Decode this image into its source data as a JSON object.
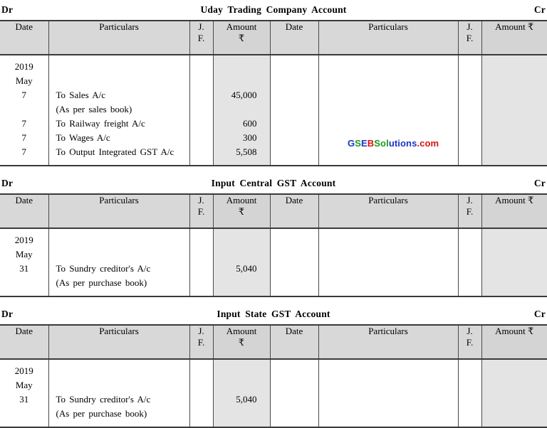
{
  "document": {
    "type": "accounting-ledger-page",
    "watermark": {
      "parts": [
        "G",
        "S",
        "E",
        "B",
        "Sol",
        "utions",
        ".com"
      ],
      "full_text": "GSEBSolutions.com",
      "colors": {
        "blue": "#1b35c4",
        "green": "#1a9c1a",
        "red": "#d81212"
      }
    }
  },
  "columns": {
    "date": "Date",
    "particulars": "Particulars",
    "jf_line1": "J.",
    "jf_line2": "F.",
    "amount_line1": "Amount",
    "amount_line2": "₹",
    "amount_inline": "Amount ₹"
  },
  "ledgers": [
    {
      "dr": "Dr",
      "title": "Uday  Trading  Company  Account",
      "cr": "Cr",
      "debit": {
        "date_lines": [
          "2019",
          "May",
          "7",
          "",
          "7",
          "7",
          "7"
        ],
        "particulars_lines": [
          "",
          "",
          "To  Sales  A/c",
          "(As  per  sales  book)",
          "To  Railway  freight  A/c",
          "To  Wages  A/c",
          "To  Output  Integrated  GST  A/c"
        ],
        "jf_lines": [
          "",
          "",
          "",
          "",
          "",
          "",
          ""
        ],
        "amount_lines": [
          "",
          "",
          "45,000",
          "",
          "600",
          "300",
          "5,508"
        ]
      },
      "credit": {
        "date_lines": [
          "",
          "",
          "",
          "",
          "",
          "",
          ""
        ],
        "particulars_lines": [
          "",
          "",
          "",
          "",
          "",
          "",
          ""
        ],
        "jf_lines": [
          "",
          "",
          "",
          "",
          "",
          "",
          ""
        ],
        "amount_lines": [
          "",
          "",
          "",
          "",
          "",
          "",
          ""
        ]
      }
    },
    {
      "dr": "Dr",
      "title": "Input  Central  GST  Account",
      "cr": "Cr",
      "debit": {
        "date_lines": [
          "2019",
          "May",
          "31",
          ""
        ],
        "particulars_lines": [
          "",
          "",
          "To  Sundry  creditor's  A/c",
          "(As  per  purchase  book)"
        ],
        "jf_lines": [
          "",
          "",
          "",
          ""
        ],
        "amount_lines": [
          "",
          "",
          "5,040",
          ""
        ]
      },
      "credit": {
        "date_lines": [
          "",
          "",
          "",
          ""
        ],
        "particulars_lines": [
          "",
          "",
          "",
          ""
        ],
        "jf_lines": [
          "",
          "",
          "",
          ""
        ],
        "amount_lines": [
          "",
          "",
          "",
          ""
        ]
      }
    },
    {
      "dr": "Dr",
      "title": "Input  State  GST  Account",
      "cr": "Cr",
      "debit": {
        "date_lines": [
          "2019",
          "May",
          "31",
          ""
        ],
        "particulars_lines": [
          "",
          "",
          "To  Sundry  creditor's  A/c",
          "(As  per  purchase  book)"
        ],
        "jf_lines": [
          "",
          "",
          "",
          ""
        ],
        "amount_lines": [
          "",
          "",
          "5,040",
          ""
        ]
      },
      "credit": {
        "date_lines": [
          "",
          "",
          "",
          ""
        ],
        "particulars_lines": [
          "",
          "",
          "",
          ""
        ],
        "jf_lines": [
          "",
          "",
          "",
          ""
        ],
        "amount_lines": [
          "",
          "",
          "",
          ""
        ]
      }
    }
  ]
}
